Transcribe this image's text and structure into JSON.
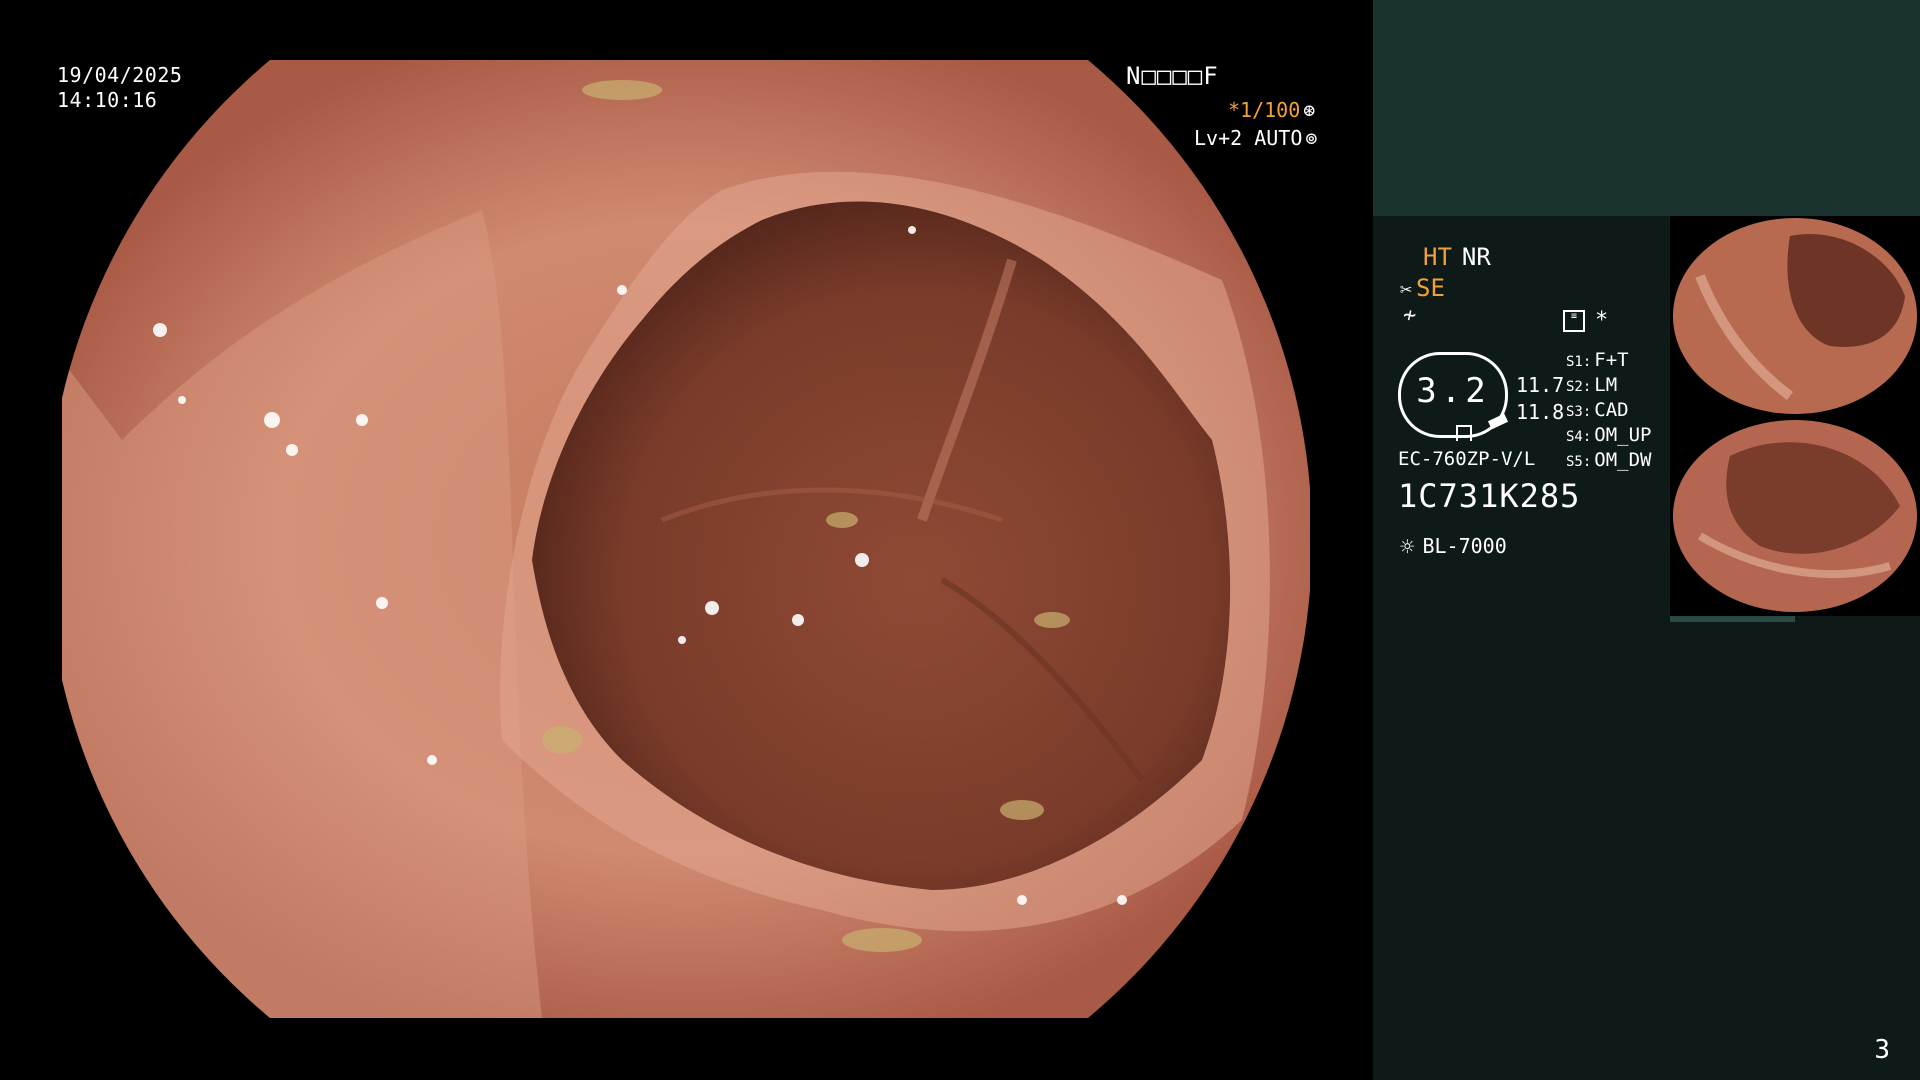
{
  "overlay": {
    "date": "19/04/2025",
    "time": "14:10:16",
    "patient_id": "N□□□□F",
    "shutter": "*1/100",
    "level": "Lv+2 AUTO"
  },
  "panel": {
    "ht": "HT",
    "nr": "NR",
    "se": "SE",
    "memo_mark": "*",
    "scope_value": "3.2",
    "num1": "11.7",
    "num2": "11.8",
    "model": "EC-760ZP-V/L",
    "serial": "1C731K285",
    "light_source": "BL-7000",
    "slots": [
      {
        "key": "S1:",
        "value": "F+T"
      },
      {
        "key": "S2:",
        "value": "LM"
      },
      {
        "key": "S3:",
        "value": "CAD"
      },
      {
        "key": "S4:",
        "value": "OM_UP"
      },
      {
        "key": "S5:",
        "value": "OM_DW"
      }
    ],
    "page_number": "3"
  },
  "icons": [
    "shutter-icon",
    "auto-iris-icon",
    "scissors-icon",
    "zigzag-icon",
    "memo-icon",
    "light-source-icon"
  ],
  "colors": {
    "accent": "#f0a23a",
    "panel_bg": "#0e1a18",
    "panel_top": "#1a332f"
  }
}
